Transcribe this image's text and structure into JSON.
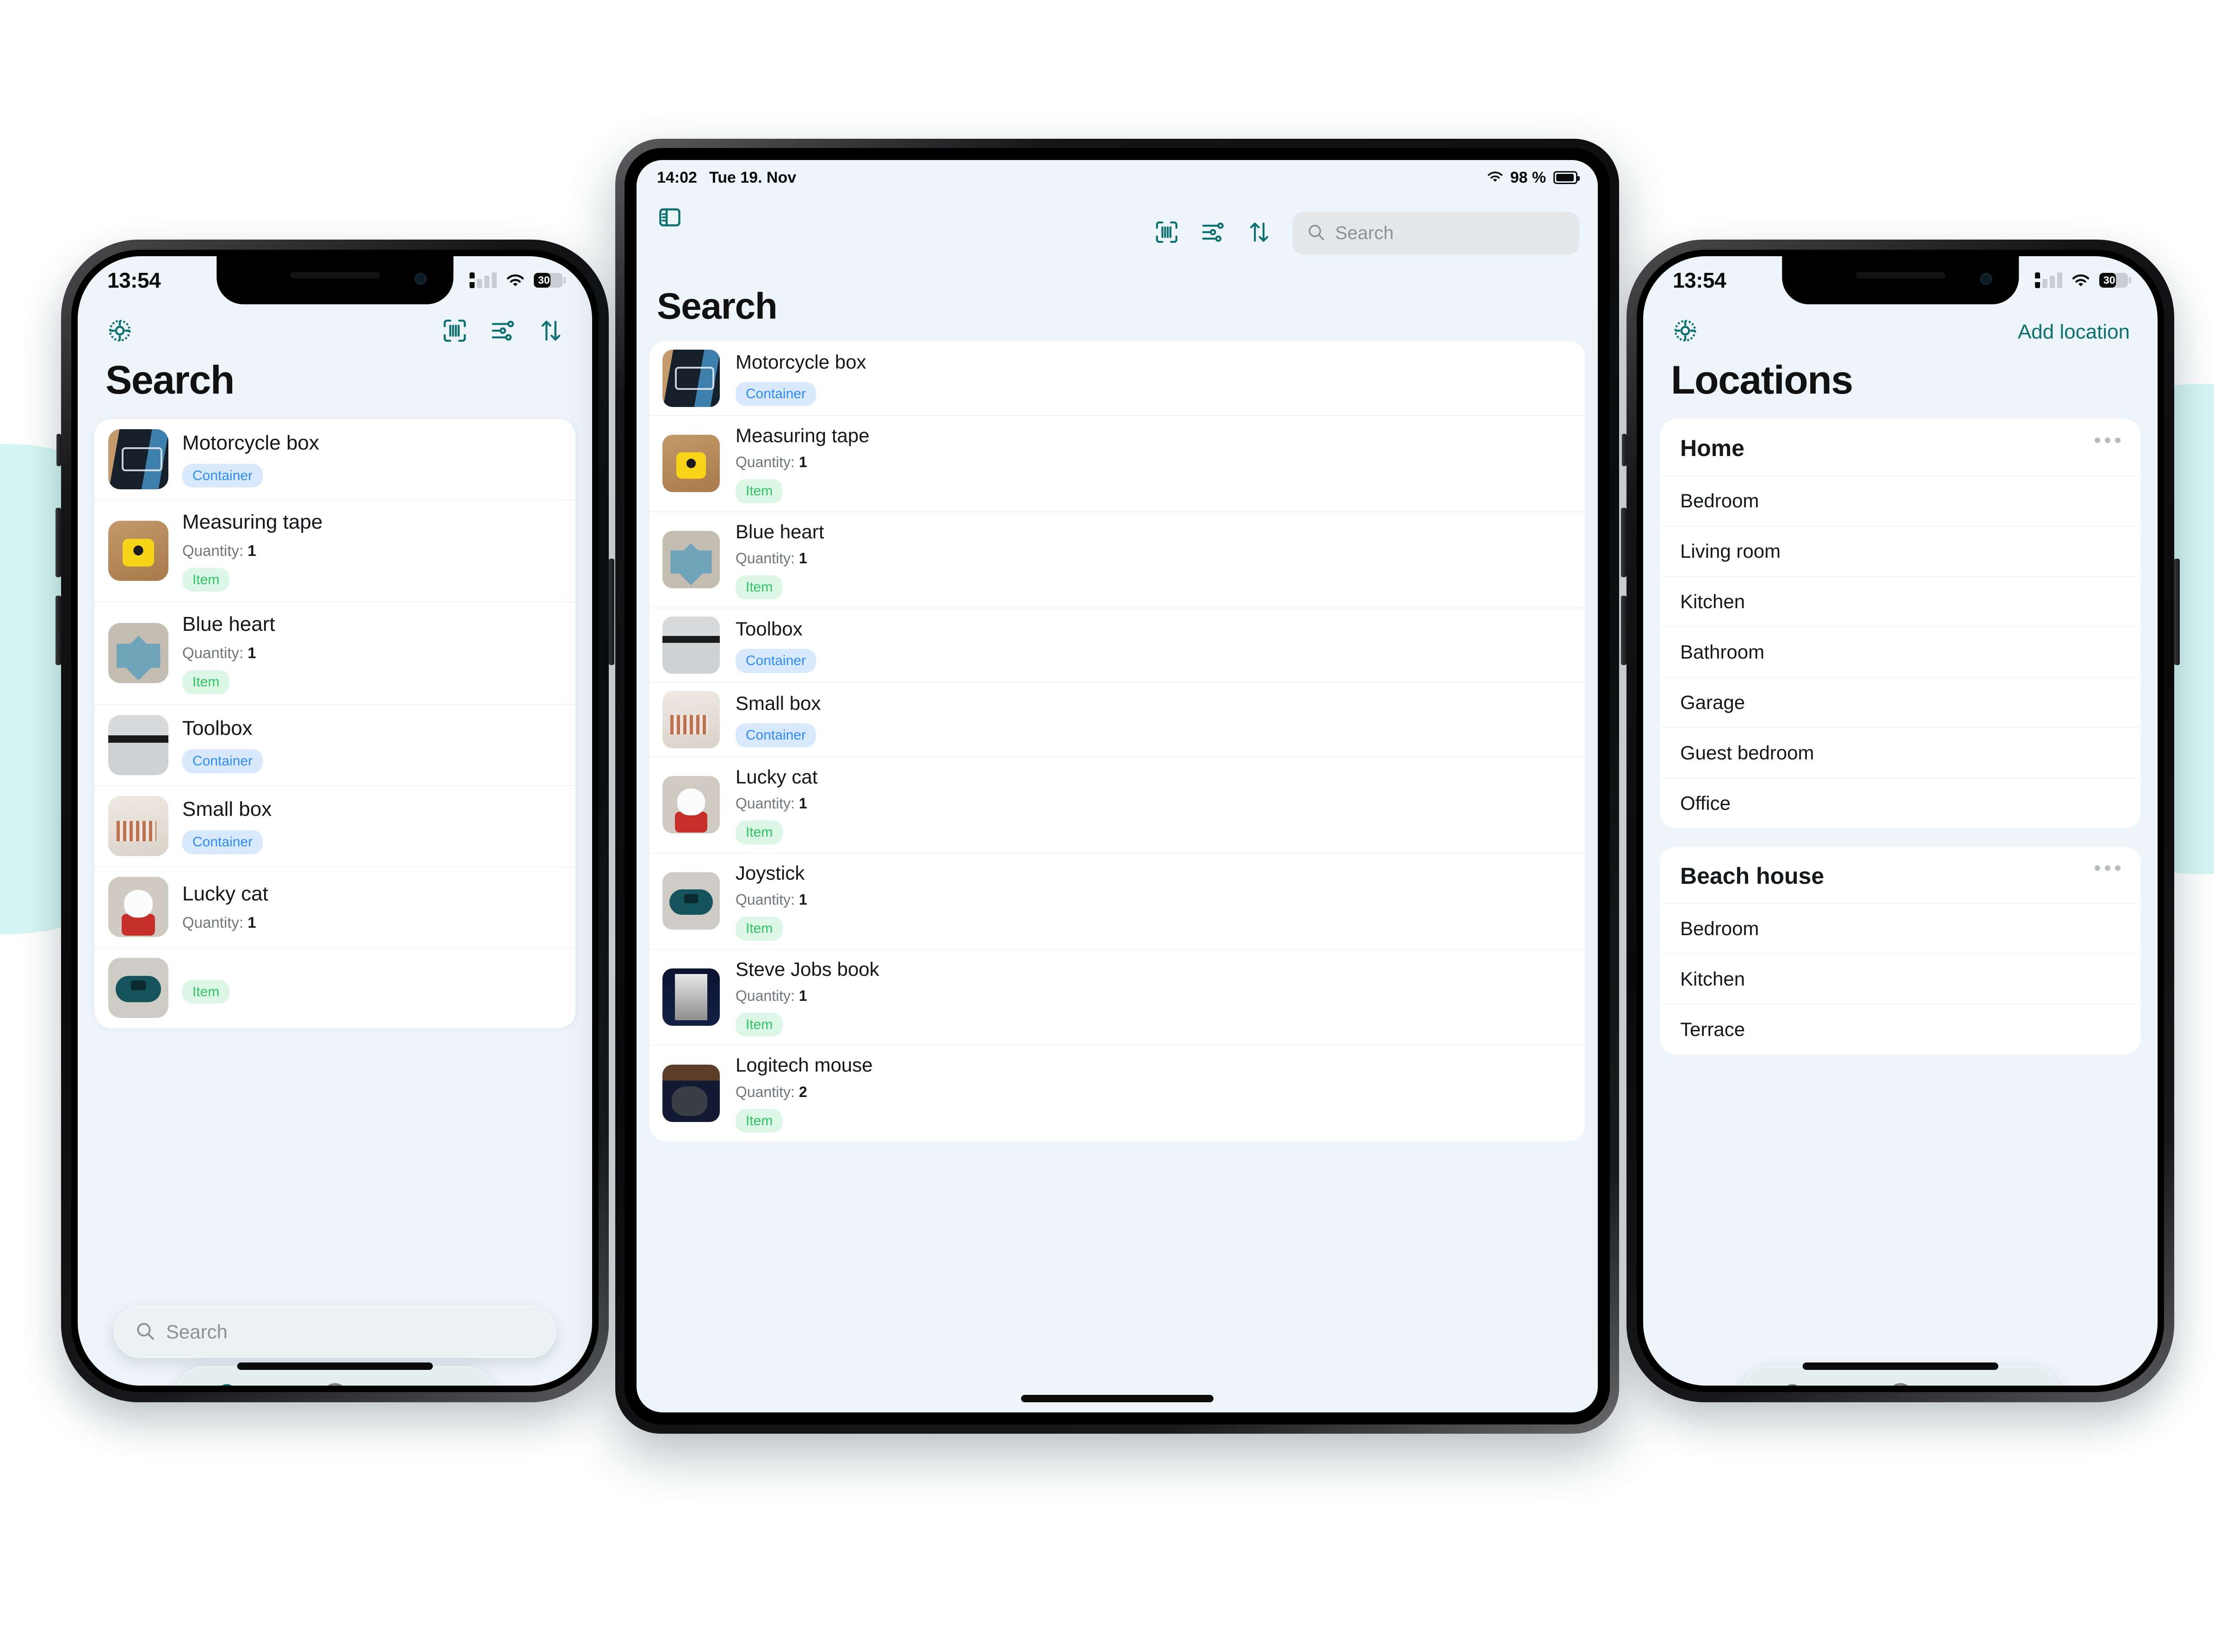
{
  "theme": {
    "accent": "#0d7070",
    "container_pill_bg": "#d9e9fd",
    "container_pill_fg": "#2d8bfb",
    "item_pill_bg": "#ddf7e6",
    "item_pill_fg": "#2fc365",
    "screen_bg": "#eef5fa",
    "blob": "#d5f6f4"
  },
  "phone_left": {
    "status": {
      "time": "13:54",
      "battery_pct": "30"
    },
    "nav": {
      "settings_icon": "gear-icon",
      "barcode_icon": "barcode-scan-icon",
      "filter_icon": "filter-sliders-icon",
      "sort_icon": "sort-arrows-icon"
    },
    "title": "Search",
    "search": {
      "placeholder": "Search",
      "value": ""
    },
    "tabs": [
      {
        "icon": "search-icon",
        "active": true
      },
      {
        "icon": "plus-circle-icon",
        "active": false
      },
      {
        "icon": "list-icon",
        "active": false
      }
    ],
    "rows": [
      {
        "title": "Motorcycle box",
        "qty_label": "",
        "qty": "",
        "badge": "Container",
        "badge_kind": "container",
        "art": "ph-moto"
      },
      {
        "title": "Measuring tape",
        "qty_label": "Quantity:",
        "qty": "1",
        "badge": "Item",
        "badge_kind": "item",
        "art": "ph-tape"
      },
      {
        "title": "Blue heart",
        "qty_label": "Quantity:",
        "qty": "1",
        "badge": "Item",
        "badge_kind": "item",
        "art": "ph-heart"
      },
      {
        "title": "Toolbox",
        "qty_label": "",
        "qty": "",
        "badge": "Container",
        "badge_kind": "container",
        "art": "ph-toolbox"
      },
      {
        "title": "Small box",
        "qty_label": "",
        "qty": "",
        "badge": "Container",
        "badge_kind": "container",
        "art": "ph-smallbox"
      },
      {
        "title": "Lucky cat",
        "qty_label": "Quantity:",
        "qty": "1",
        "badge": "",
        "badge_kind": "item",
        "art": "ph-cat"
      },
      {
        "title": "",
        "qty_label": "",
        "qty": "",
        "badge": "Item",
        "badge_kind": "item",
        "art": "ph-joy"
      }
    ]
  },
  "tablet": {
    "status": {
      "time": "14:02",
      "date": "Tue 19. Nov",
      "battery_pct": "98 %"
    },
    "sidebar_toggle_icon": "sidebar-toggle-icon",
    "toolbar": {
      "barcode_icon": "barcode-scan-icon",
      "filter_icon": "filter-sliders-icon",
      "sort_icon": "sort-arrows-icon"
    },
    "search": {
      "placeholder": "Search",
      "value": ""
    },
    "title": "Search",
    "rows": [
      {
        "title": "Motorcycle box",
        "qty_label": "",
        "qty": "",
        "badge": "Container",
        "badge_kind": "container",
        "art": "ph-moto"
      },
      {
        "title": "Measuring tape",
        "qty_label": "Quantity:",
        "qty": "1",
        "badge": "Item",
        "badge_kind": "item",
        "art": "ph-tape"
      },
      {
        "title": "Blue heart",
        "qty_label": "Quantity:",
        "qty": "1",
        "badge": "Item",
        "badge_kind": "item",
        "art": "ph-heart"
      },
      {
        "title": "Toolbox",
        "qty_label": "",
        "qty": "",
        "badge": "Container",
        "badge_kind": "container",
        "art": "ph-toolbox"
      },
      {
        "title": "Small box",
        "qty_label": "",
        "qty": "",
        "badge": "Container",
        "badge_kind": "container",
        "art": "ph-smallbox"
      },
      {
        "title": "Lucky cat",
        "qty_label": "Quantity:",
        "qty": "1",
        "badge": "Item",
        "badge_kind": "item",
        "art": "ph-cat"
      },
      {
        "title": "Joystick",
        "qty_label": "Quantity:",
        "qty": "1",
        "badge": "Item",
        "badge_kind": "item",
        "art": "ph-joy"
      },
      {
        "title": "Steve Jobs book",
        "qty_label": "Quantity:",
        "qty": "1",
        "badge": "Item",
        "badge_kind": "item",
        "art": "ph-jobs"
      },
      {
        "title": "Logitech mouse",
        "qty_label": "Quantity:",
        "qty": "2",
        "badge": "Item",
        "badge_kind": "item",
        "art": "ph-mouse"
      }
    ]
  },
  "phone_right": {
    "status": {
      "time": "13:54",
      "battery_pct": "30"
    },
    "nav": {
      "settings_icon": "gear-icon",
      "add_location_label": "Add location"
    },
    "title": "Locations",
    "groups": [
      {
        "name": "Home",
        "items": [
          "Bedroom",
          "Living room",
          "Kitchen",
          "Bathroom",
          "Garage",
          "Guest bedroom",
          "Office"
        ]
      },
      {
        "name": "Beach house",
        "items": [
          "Bedroom",
          "Kitchen",
          "Terrace"
        ]
      }
    ],
    "tabs": [
      {
        "icon": "search-icon",
        "active": false
      },
      {
        "icon": "plus-circle-icon",
        "active": false
      },
      {
        "icon": "list-icon",
        "active": true
      }
    ]
  }
}
